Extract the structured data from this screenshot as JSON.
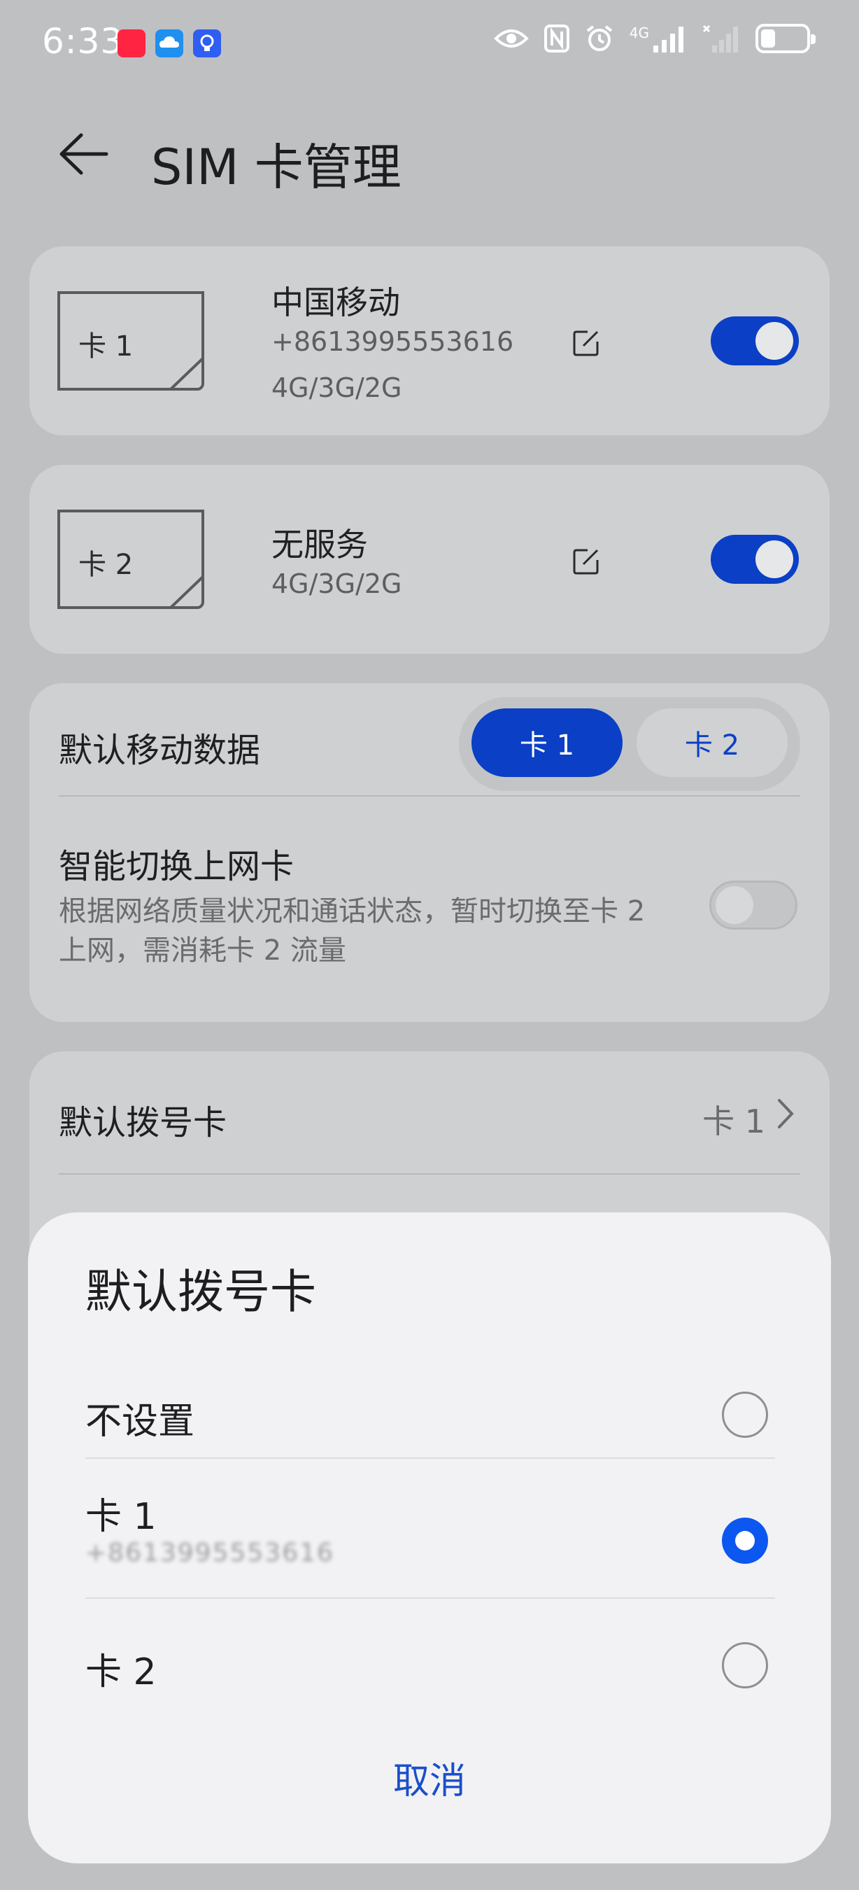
{
  "status_bar": {
    "time": "6:33",
    "network": "4G",
    "icons": [
      "eye-icon",
      "nfc-icon",
      "alarm-icon",
      "signal-icon",
      "no-signal-icon",
      "battery-icon"
    ]
  },
  "app_bar": {
    "title": "SIM 卡管理"
  },
  "sim_cards": [
    {
      "badge": "卡 1",
      "carrier": "中国移动",
      "number": "+8613995553616",
      "network_types": "4G/3G/2G",
      "enabled": true
    },
    {
      "badge": "卡 2",
      "carrier": "无服务",
      "network_types": "4G/3G/2G",
      "enabled": true
    }
  ],
  "default_data": {
    "label": "默认移动数据",
    "options": [
      "卡 1",
      "卡 2"
    ],
    "selected": "卡 1"
  },
  "smart_switch": {
    "title": "智能切换上网卡",
    "description": "根据网络质量状况和通话状态，暂时切换至卡 2 上网，需消耗卡 2 流量",
    "enabled": false
  },
  "default_dial": {
    "label": "默认拨号卡",
    "value": "卡 1"
  },
  "sheet": {
    "title": "默认拨号卡",
    "options": [
      {
        "label": "不设置",
        "selected": false
      },
      {
        "label": "卡 1",
        "sublabel": "+8613995553616",
        "selected": true
      },
      {
        "label": "卡 2",
        "selected": false
      }
    ],
    "cancel_label": "取消"
  },
  "colors": {
    "accent": "#0a3fc6",
    "radio_selected": "#0b57f0",
    "sheet_bg": "#f2f2f4",
    "dimmed_bg": "#bfc0c2"
  }
}
